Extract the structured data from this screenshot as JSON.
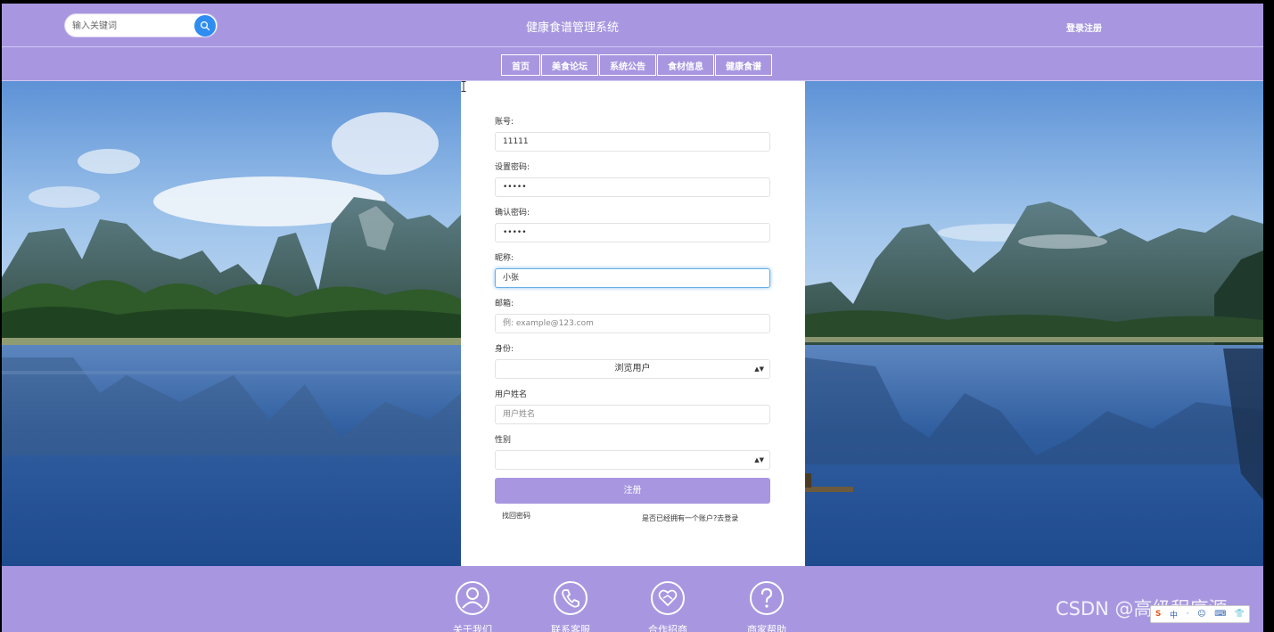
{
  "header": {
    "search_placeholder": "输入关键词",
    "title": "健康食谱管理系统",
    "login_register": "登录注册"
  },
  "nav": {
    "items": [
      "首页",
      "美食论坛",
      "系统公告",
      "食材信息",
      "健康食谱"
    ]
  },
  "form": {
    "account_label": "账号:",
    "account_value": "11111",
    "password_label": "设置密码:",
    "password_value": "•••••",
    "confirm_label": "确认密码:",
    "confirm_value": "•••••",
    "nickname_label": "昵称:",
    "nickname_value": "小张",
    "email_label": "邮箱:",
    "email_placeholder": "例: example@123.com",
    "identity_label": "身份:",
    "identity_value": "浏览用户",
    "realname_label": "用户姓名",
    "realname_placeholder": "用户姓名",
    "gender_label": "性别",
    "gender_value": "",
    "register_button": "注册",
    "forgot_password": "找回密码",
    "have_account": "是否已经拥有一个账户?去登录"
  },
  "footer": {
    "items": [
      {
        "label": "关于我们",
        "icon": "person-icon"
      },
      {
        "label": "联系客服",
        "icon": "phone-icon"
      },
      {
        "label": "合作招商",
        "icon": "handshake-icon"
      },
      {
        "label": "商家帮助",
        "icon": "help-icon"
      }
    ]
  },
  "overlay": {
    "watermark": "CSDN @高级程序源",
    "ime_items": [
      "S",
      "中",
      "·",
      "☺",
      "⌨",
      "👕"
    ]
  },
  "colors": {
    "primary": "#a897e0",
    "search_button": "#2f8cf0"
  }
}
